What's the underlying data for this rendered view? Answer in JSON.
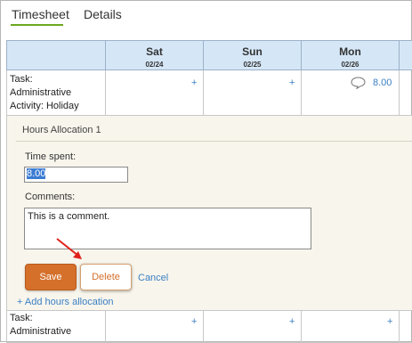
{
  "tabs": [
    {
      "label": "Timesheet",
      "active": true
    },
    {
      "label": "Details",
      "active": false
    }
  ],
  "days": [
    {
      "day": "Sat",
      "date": "02/24"
    },
    {
      "day": "Sun",
      "date": "02/25"
    },
    {
      "day": "Mon",
      "date": "02/26"
    }
  ],
  "row1": {
    "task_line1": "Task:",
    "task_line2": "Administrative",
    "task_line3": "Activity: Holiday",
    "sat": "+",
    "sun": "+",
    "mon_hours": "8.00"
  },
  "allocation": {
    "title": "Hours Allocation 1",
    "time_label": "Time spent:",
    "time_value": "8.00",
    "comments_label": "Comments:",
    "comments_value": "This is a comment.",
    "save_label": "Save",
    "delete_label": "Delete",
    "cancel_label": "Cancel",
    "add_label": "+ Add hours allocation"
  },
  "row2": {
    "task_line1": "Task:",
    "task_line2": "Administrative",
    "sat": "+",
    "sun": "+",
    "mon": "+"
  },
  "icons": {
    "comment": "comment-bubble-icon",
    "arrow": "red-arrow-pointer"
  },
  "colors": {
    "header_bg": "#d5e7f7",
    "panel_bg": "#f8f5ec",
    "accent_orange": "#d5702b",
    "link_blue": "#3a7fc4",
    "tab_underline": "#6aa81e",
    "arrow_red": "#e0201b"
  }
}
